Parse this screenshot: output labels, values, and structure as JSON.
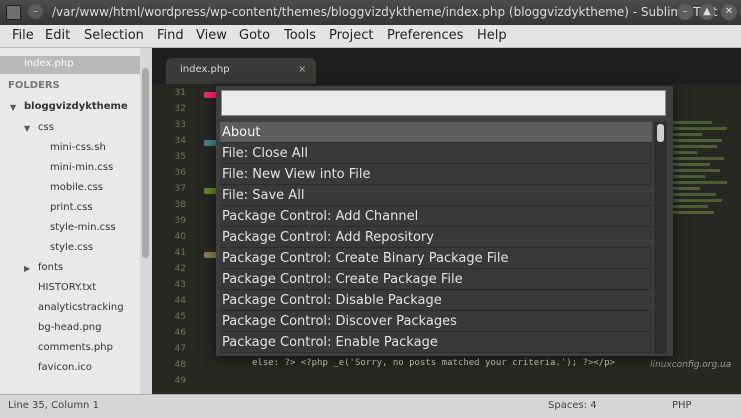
{
  "window": {
    "title": "/var/www/html/wordpress/wp-content/themes/bloggvizdyktheme/index.php (bloggvizdyktheme) - Sublime Text"
  },
  "menu": [
    "File",
    "Edit",
    "Selection",
    "Find",
    "View",
    "Goto",
    "Tools",
    "Project",
    "Preferences",
    "Help"
  ],
  "sidebar": {
    "open_file": "index.php",
    "folders_header": "FOLDERS",
    "root_folder": "bloggvizdyktheme",
    "css_folder": "css",
    "css_files": [
      "mini-css.sh",
      "mini-min.css",
      "mobile.css",
      "print.css",
      "style-min.css",
      "style.css"
    ],
    "fonts_folder": "fonts",
    "root_files": [
      "HISTORY.txt",
      "analyticstracking",
      "bg-head.png",
      "comments.php",
      "favicon.ico"
    ]
  },
  "editor": {
    "tab_label": "index.php",
    "tab_close": "×",
    "line_numbers": [
      "31",
      "32",
      "33",
      "34",
      "35",
      "36",
      "37",
      "38",
      "39",
      "40",
      "41",
      "42",
      "43",
      "44",
      "45",
      "46",
      "47",
      "48",
      "49"
    ],
    "visible_code": "else: ?> <?php _e('Sorry, no posts matched your criteria.'); ?></p>"
  },
  "command_palette": {
    "query": "",
    "items": [
      "About",
      "File: Close All",
      "File: New View into File",
      "File: Save All",
      "Package Control: Add Channel",
      "Package Control: Add Repository",
      "Package Control: Create Binary Package File",
      "Package Control: Create Package File",
      "Package Control: Disable Package",
      "Package Control: Discover Packages",
      "Package Control: Enable Package"
    ],
    "selected_index": 0
  },
  "status": {
    "position": "Line 35, Column 1",
    "spaces": "Spaces: 4",
    "syntax": "PHP"
  },
  "watermark": "linuxconfig.org.ua"
}
